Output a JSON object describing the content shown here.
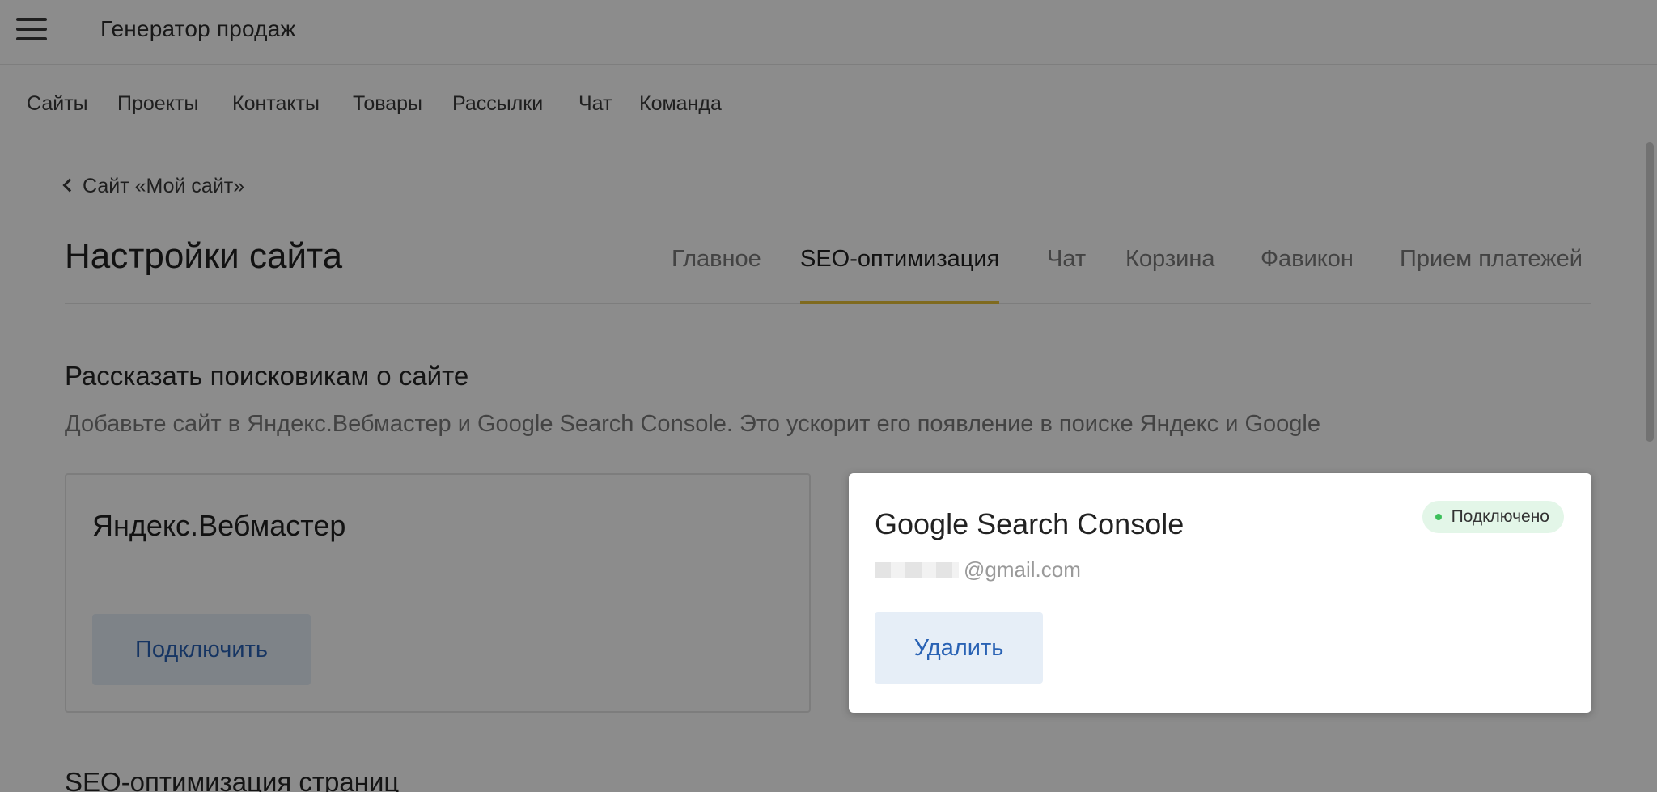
{
  "header": {
    "brand": "Генератор продаж"
  },
  "main_nav": {
    "items": [
      {
        "label": "Сайты"
      },
      {
        "label": "Проекты"
      },
      {
        "label": "Контакты"
      },
      {
        "label": "Товары"
      },
      {
        "label": "Рассылки"
      },
      {
        "label": "Чат"
      },
      {
        "label": "Команда"
      }
    ]
  },
  "breadcrumb": {
    "back_label": "Сайт «Мой сайт»",
    "icon": "chevron-left-icon"
  },
  "page": {
    "title": "Настройки сайта"
  },
  "tabs": [
    {
      "label": "Главное",
      "active": false
    },
    {
      "label": "SEO-оптимизация",
      "active": true
    },
    {
      "label": "Чат",
      "active": false
    },
    {
      "label": "Корзина",
      "active": false
    },
    {
      "label": "Фавикон",
      "active": false
    },
    {
      "label": "Прием платежей",
      "active": false
    }
  ],
  "search_section": {
    "title": "Рассказать поисковикам о сайте",
    "description": "Добавьте сайт в Яндекс.Вебмастер и Google Search Console. Это ускорит его появление в поиске Яндекс и Google"
  },
  "yandex_card": {
    "title": "Яндекс.Вебмастер",
    "button_label": "Подключить"
  },
  "google_card": {
    "title": "Google Search Console",
    "status": "Подключено",
    "email_domain": "@gmail.com",
    "button_label": "Удалить"
  },
  "seo_pages_section": {
    "title": "SEO-оптимизация страниц"
  },
  "colors": {
    "accent_tab": "#e8c23a",
    "button_bg": "#e6eef7",
    "button_text": "#2962b4",
    "status_bg": "#e3f6e8",
    "status_dot": "#3cbf5a"
  }
}
